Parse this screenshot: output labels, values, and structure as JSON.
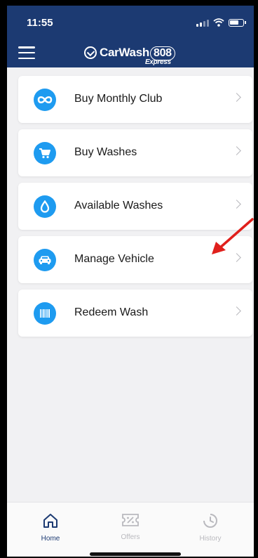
{
  "status_bar": {
    "time": "11:55"
  },
  "header": {
    "logo_text": "CarWash",
    "logo_number": "808",
    "logo_sub": "Express",
    "background_color": "#1c3a72"
  },
  "menu": {
    "accent_color": "#1e9bf0",
    "items": [
      {
        "label": "Buy Monthly Club",
        "icon": "infinity-icon"
      },
      {
        "label": "Buy Washes",
        "icon": "cart-icon"
      },
      {
        "label": "Available Washes",
        "icon": "water-drop-icon"
      },
      {
        "label": "Manage Vehicle",
        "icon": "car-icon"
      },
      {
        "label": "Redeem Wash",
        "icon": "barcode-icon"
      }
    ]
  },
  "annotation": {
    "arrow_color": "#e0201c"
  },
  "tabbar": {
    "tabs": [
      {
        "label": "Home",
        "icon": "home-icon",
        "active": true
      },
      {
        "label": "Offers",
        "icon": "offers-icon",
        "active": false
      },
      {
        "label": "History",
        "icon": "history-icon",
        "active": false
      }
    ],
    "active_color": "#1c3a72",
    "inactive_color": "#b9b9be"
  }
}
